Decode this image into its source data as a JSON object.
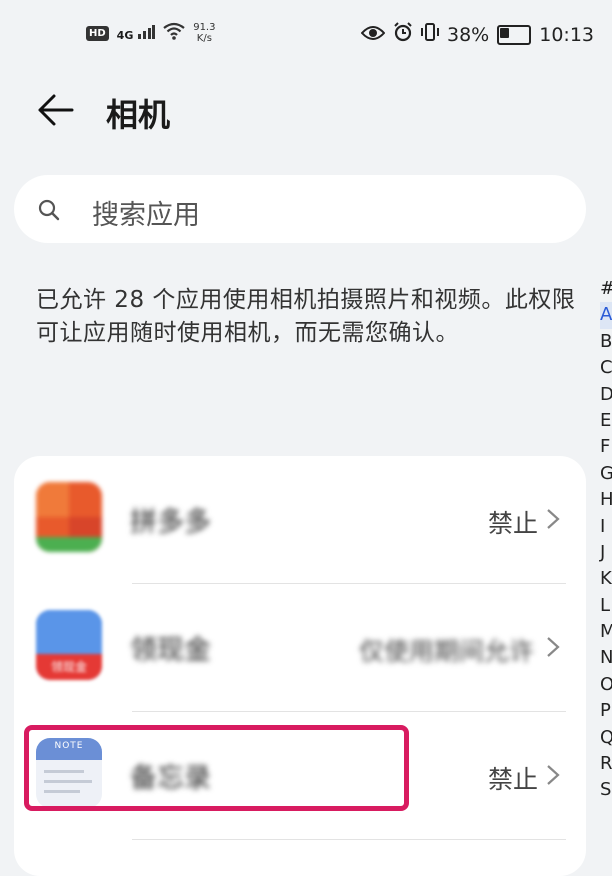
{
  "status_bar": {
    "hd": "HD",
    "signal": "4G",
    "net_speed_value": "91.3",
    "net_speed_unit": "K/s",
    "battery": "38%",
    "battery_level": 0.38,
    "time": "10:13"
  },
  "header": {
    "title": "相机"
  },
  "search": {
    "placeholder": "搜索应用"
  },
  "description": "已允许 28 个应用使用相机拍摄照片和视频。此权限可让应用随时使用相机，而无需您确认。",
  "alphabet_index": [
    "#",
    "A",
    "B",
    "C",
    "D",
    "E",
    "F",
    "G",
    "H",
    "I",
    "J",
    "K",
    "L",
    "M",
    "N",
    "O",
    "P",
    "Q",
    "R",
    "S"
  ],
  "alphabet_active": "A",
  "apps": [
    {
      "name": "拼多多",
      "status": "禁止",
      "icon_color": "#e85a2c"
    },
    {
      "name": "领现金",
      "status": "仅使用期间允许",
      "icon_label": "领现金",
      "icon_color": "#3d7bdc"
    },
    {
      "name": "备忘录",
      "status": "禁止",
      "icon_label": "NOTE",
      "icon_color": "#6b8fd6"
    }
  ]
}
